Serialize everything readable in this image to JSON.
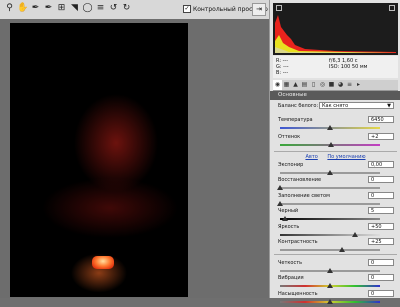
{
  "toolbar": {
    "tools": [
      "zoom-icon",
      "hand-icon",
      "white-balance-icon",
      "color-sampler-icon",
      "crop-icon",
      "straighten-icon",
      "red-eye-icon",
      "presets-icon",
      "rotate-left-icon",
      "rotate-right-icon"
    ],
    "preview_label": "Контрольный просмотр",
    "preview_checked": "✓",
    "fullscreen_glyph": "⇥"
  },
  "info": {
    "r": "R:   ---",
    "g": "G:   ---",
    "b": "B:   ---",
    "aperture_shutter": "f/6,3    1,60 с",
    "iso_focal": "ISO: 100    50 мм"
  },
  "panel": {
    "title": "Основные",
    "wb_label": "Баланс белого:",
    "wb_value": "Как снято",
    "link_auto": "Авто",
    "link_default": "По умолчанию",
    "sliders": [
      {
        "label": "Температура",
        "value": "6450",
        "fraction": 0.5
      },
      {
        "label": "Оттенок",
        "value": "+2",
        "fraction": 0.51
      },
      {
        "label": "Экспонир",
        "value": "0,00",
        "fraction": 0.5
      },
      {
        "label": "Восстановление",
        "value": "0",
        "fraction": 0.0
      },
      {
        "label": "Заполнение светом",
        "value": "0",
        "fraction": 0.0
      },
      {
        "label": "Черный",
        "value": "5",
        "fraction": 0.05
      },
      {
        "label": "Яркость",
        "value": "+50",
        "fraction": 0.75
      },
      {
        "label": "Контрастность",
        "value": "+25",
        "fraction": 0.62
      },
      {
        "label": "Четкость",
        "value": "0",
        "fraction": 0.5
      },
      {
        "label": "Вибрация",
        "value": "0",
        "fraction": 0.5
      },
      {
        "label": "Насыщенность",
        "value": "0",
        "fraction": 0.5
      }
    ]
  },
  "colors": {
    "histogram_red": "#e8231d",
    "histogram_yellow": "#e8e020",
    "accent_link": "#1a3fb0"
  }
}
